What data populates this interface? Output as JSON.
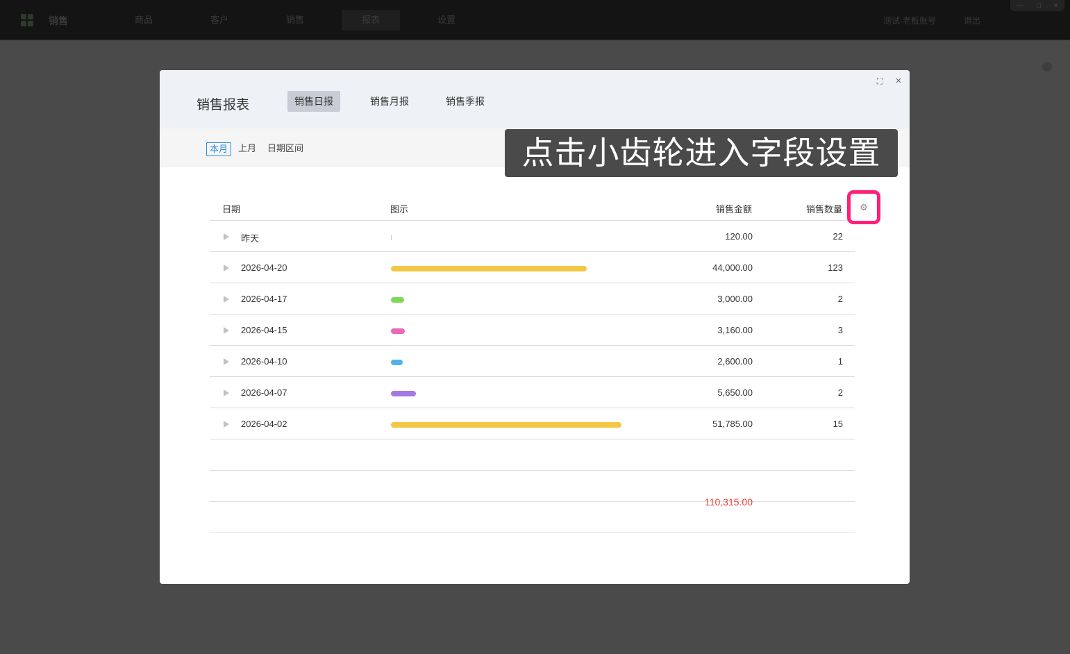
{
  "app": {
    "name": "销售",
    "nav": [
      "商品",
      "客户",
      "销售",
      "报表",
      "设置"
    ],
    "active_nav": "报表",
    "account": "测试-老板账号",
    "logout": "退出",
    "window_controls": [
      "—",
      "□",
      "×"
    ]
  },
  "modal": {
    "title": "销售报表",
    "tabs": [
      "销售日报",
      "销售月报",
      "销售季报"
    ],
    "active_tab": "销售日报",
    "expand_icon": "⛶",
    "close_icon": "×",
    "filters": [
      "本月",
      "上月",
      "日期区间"
    ],
    "active_filter": "本月"
  },
  "table": {
    "headers": {
      "date": "日期",
      "chart": "图示",
      "amount": "销售金额",
      "quantity": "销售数量"
    },
    "rows": [
      {
        "date": "昨天",
        "amount": "120.00",
        "quantity": "22",
        "bar_fraction": 0.0023,
        "bar_color": "#cccccc"
      },
      {
        "date": "2026-04-20",
        "amount": "44,000.00",
        "quantity": "123",
        "bar_fraction": 0.85,
        "bar_color": "#f3c744"
      },
      {
        "date": "2026-04-17",
        "amount": "3,000.00",
        "quantity": "2",
        "bar_fraction": 0.058,
        "bar_color": "#7ed957"
      },
      {
        "date": "2026-04-15",
        "amount": "3,160.00",
        "quantity": "3",
        "bar_fraction": 0.061,
        "bar_color": "#e96bb4"
      },
      {
        "date": "2026-04-10",
        "amount": "2,600.00",
        "quantity": "1",
        "bar_fraction": 0.05,
        "bar_color": "#4fb3e8"
      },
      {
        "date": "2026-04-07",
        "amount": "5,650.00",
        "quantity": "2",
        "bar_fraction": 0.109,
        "bar_color": "#a678e4"
      },
      {
        "date": "2026-04-02",
        "amount": "51,785.00",
        "quantity": "15",
        "bar_fraction": 1.0,
        "bar_color": "#f3c744"
      }
    ],
    "empty_rows": 3,
    "total_amount": "110,315.00",
    "settings_icon": "⚙"
  },
  "caption": "点击小齿轮进入字段设置"
}
